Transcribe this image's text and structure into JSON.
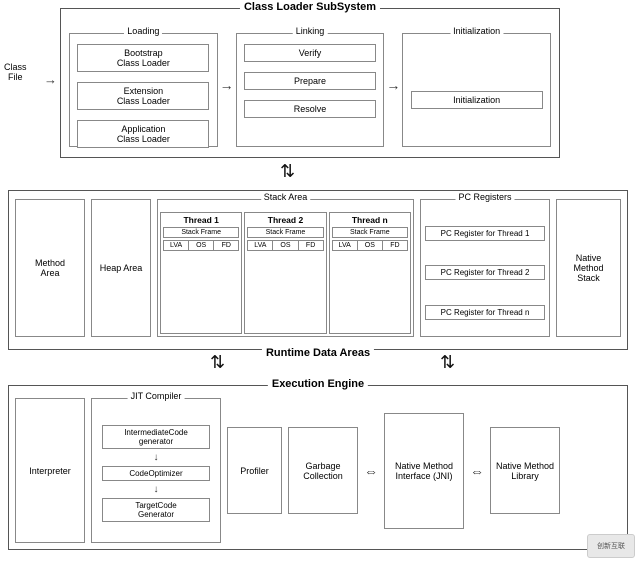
{
  "cls": {
    "title": "Class Loader SubSystem",
    "loading": {
      "label": "Loading",
      "items": [
        "Bootstrap\nClass Loader",
        "Extension\nClass Loader",
        "Application\nClass Loader"
      ]
    },
    "linking": {
      "label": "Linking",
      "items": [
        "Verify",
        "Prepare",
        "Resolve"
      ]
    },
    "initialization": {
      "label": "Initialization",
      "items": [
        "Initialization"
      ]
    }
  },
  "classfile": {
    "line1": "Class",
    "line2": "File"
  },
  "runtime": {
    "title": "Runtime Data Areas",
    "method_area": "Method\nArea",
    "heap_area": "Heap Area",
    "stack_area": "Stack Area",
    "threads": [
      {
        "name": "Thread 1",
        "frame": "Stack Frame",
        "lva": [
          "LVA",
          "OS",
          "FD"
        ]
      },
      {
        "name": "Thread 2",
        "frame": "Stack Frame",
        "lva": [
          "LVA",
          "OS",
          "FD"
        ]
      },
      {
        "name": "Thread n",
        "frame": "Stack Frame",
        "lva": [
          "LVA",
          "OS",
          "FD"
        ]
      }
    ],
    "pc_registers": "PC Registers",
    "pc_items": [
      "PC Register for Thread 1",
      "PC Register for Thread 2",
      "PC Register for Thread n"
    ],
    "native_method_stack": "Native\nMethod\nStack"
  },
  "execution": {
    "title": "Execution Engine",
    "interpreter": "Interpreter",
    "jit_title": "JIT Compiler",
    "jit_items": [
      "IntermediateCode\ngenerator",
      "CodeOptimizer",
      "TargetCode\nGenerator"
    ],
    "profiler": "Profiler",
    "garbage_collection": "Garbage\nCollection",
    "jni": "Native Method\nInterface\n(JNI)",
    "native_lib": "Native Method\nLibrary"
  },
  "watermark": "创新互联"
}
